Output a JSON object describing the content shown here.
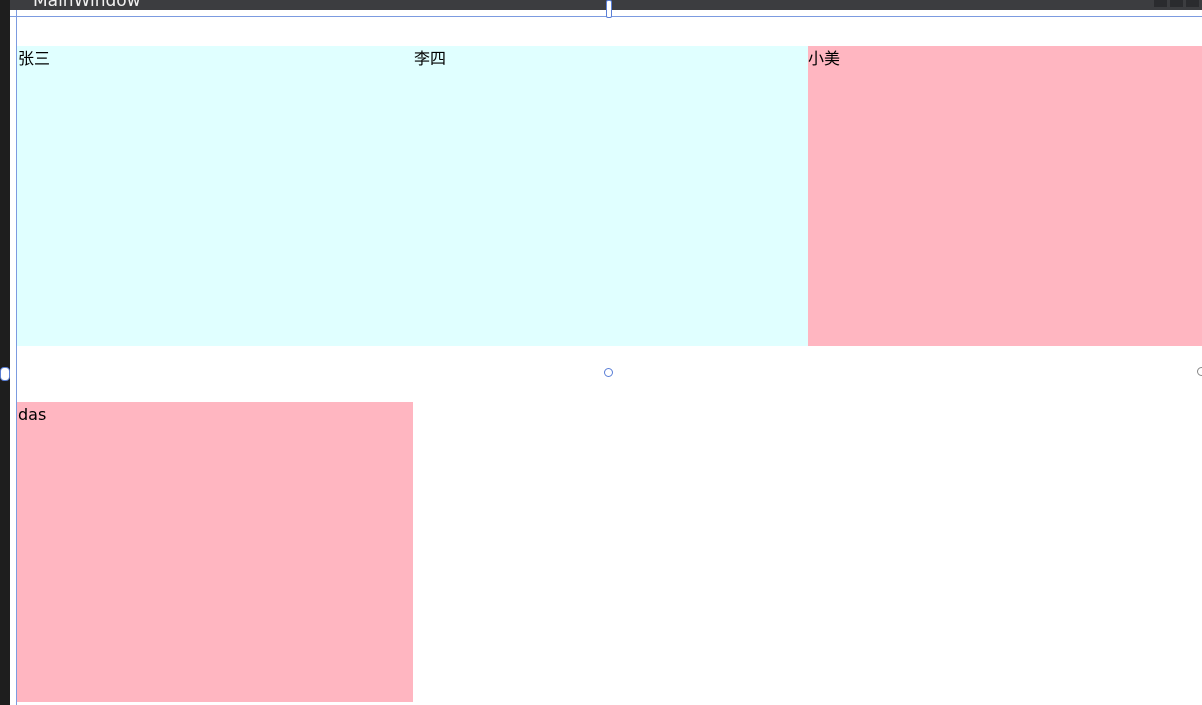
{
  "window": {
    "title": "MainWindow"
  },
  "grid": {
    "cells": [
      {
        "label": "张三",
        "color": "#e0ffff"
      },
      {
        "label": "李四",
        "color": "#e0ffff"
      },
      {
        "label": "小美",
        "color": "#ffb6c1"
      },
      {
        "label": "das",
        "color": "#ffb6c1"
      }
    ]
  },
  "colors": {
    "titlebar": "#3c3d40",
    "canvas": "#ffffff",
    "guide": "#7c9be0",
    "handle_border": "#5b7fd6"
  }
}
